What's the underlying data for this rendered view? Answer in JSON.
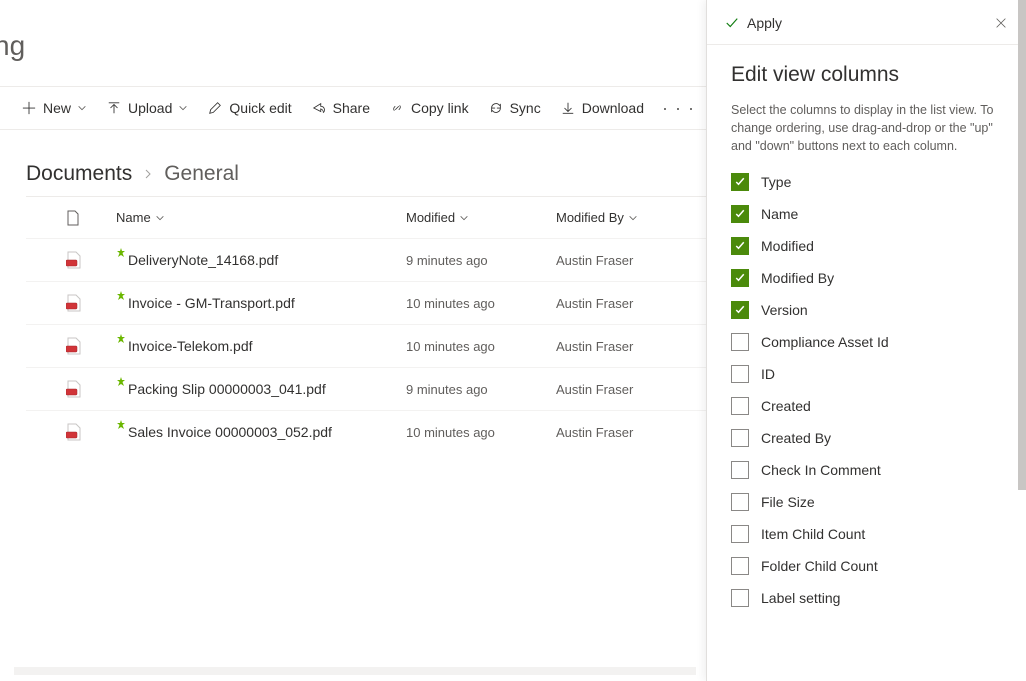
{
  "page": {
    "title_fragment": "ng"
  },
  "toolbar": {
    "new": "New",
    "upload": "Upload",
    "quick_edit": "Quick edit",
    "share": "Share",
    "copy_link": "Copy link",
    "sync": "Sync",
    "download": "Download",
    "overflow": "· · ·"
  },
  "breadcrumb": {
    "root": "Documents",
    "leaf": "General"
  },
  "list": {
    "headers": {
      "name": "Name",
      "modified": "Modified",
      "modified_by": "Modified By"
    },
    "rows": [
      {
        "name": "DeliveryNote_14168.pdf",
        "modified": "9 minutes ago",
        "modified_by": "Austin Fraser"
      },
      {
        "name": "Invoice - GM-Transport.pdf",
        "modified": "10 minutes ago",
        "modified_by": "Austin Fraser"
      },
      {
        "name": "Invoice-Telekom.pdf",
        "modified": "10 minutes ago",
        "modified_by": "Austin Fraser"
      },
      {
        "name": "Packing Slip 00000003_041.pdf",
        "modified": "9 minutes ago",
        "modified_by": "Austin Fraser"
      },
      {
        "name": "Sales Invoice 00000003_052.pdf",
        "modified": "10 minutes ago",
        "modified_by": "Austin Fraser"
      }
    ]
  },
  "panel": {
    "apply": "Apply",
    "title": "Edit view columns",
    "description": "Select the columns to display in the list view. To change ordering, use drag-and-drop or the \"up\" and \"down\" buttons next to each column.",
    "columns": [
      {
        "label": "Type",
        "checked": true
      },
      {
        "label": "Name",
        "checked": true
      },
      {
        "label": "Modified",
        "checked": true
      },
      {
        "label": "Modified By",
        "checked": true
      },
      {
        "label": "Version",
        "checked": true
      },
      {
        "label": "Compliance Asset Id",
        "checked": false
      },
      {
        "label": "ID",
        "checked": false
      },
      {
        "label": "Created",
        "checked": false
      },
      {
        "label": "Created By",
        "checked": false
      },
      {
        "label": "Check In Comment",
        "checked": false
      },
      {
        "label": "File Size",
        "checked": false
      },
      {
        "label": "Item Child Count",
        "checked": false
      },
      {
        "label": "Folder Child Count",
        "checked": false
      },
      {
        "label": "Label setting",
        "checked": false
      }
    ]
  }
}
